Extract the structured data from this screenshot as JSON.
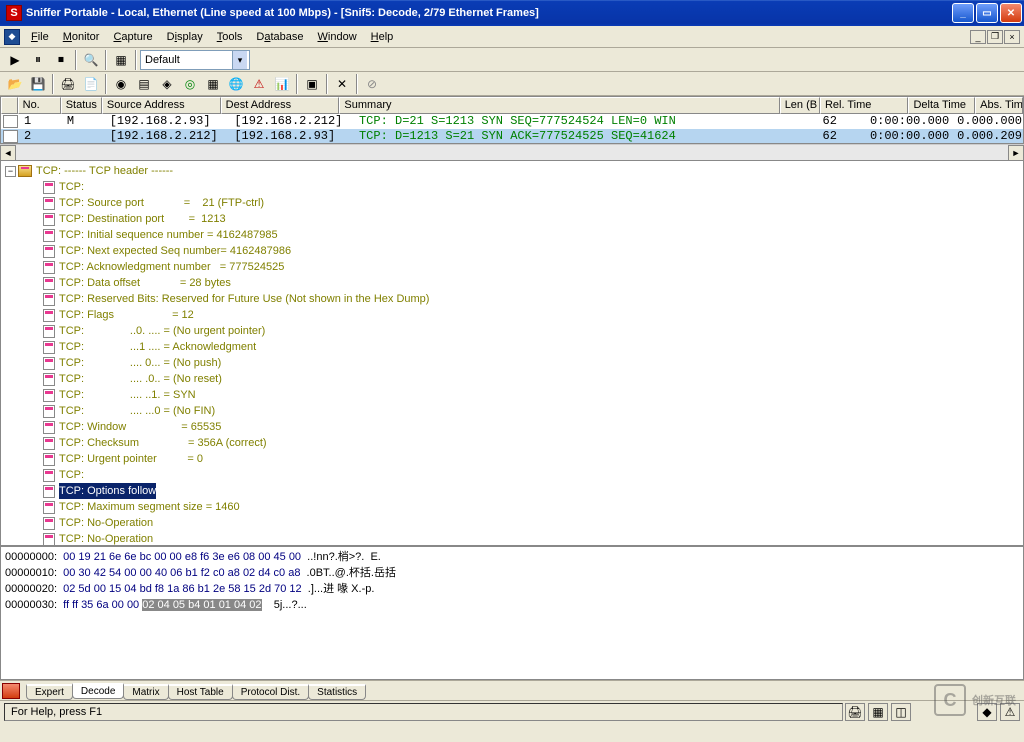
{
  "title": "Sniffer Portable - Local, Ethernet (Line speed at 100 Mbps) - [Snif5: Decode, 2/79 Ethernet Frames]",
  "menus": {
    "file": "File",
    "monitor": "Monitor",
    "capture": "Capture",
    "display": "Display",
    "tools": "Tools",
    "database": "Database",
    "window": "Window",
    "help": "Help"
  },
  "toolbar1": {
    "combo": "Default"
  },
  "packet_headers": {
    "no": "No.",
    "status": "Status",
    "src": "Source Address",
    "dst": "Dest Address",
    "summary": "Summary",
    "len": "Len (B",
    "rel": "Rel. Time",
    "delta": "Delta Time",
    "abs": "Abs. Time"
  },
  "packets": [
    {
      "no": "1",
      "status": "M",
      "src": "[192.168.2.93]",
      "dst": "[192.168.2.212]",
      "summary": "TCP: D=21 S=1213 SYN SEQ=777524524 LEN=0 WIN",
      "len": "62",
      "rel": "0:00:00.000",
      "delta": "0.000.000"
    },
    {
      "no": "2",
      "status": "",
      "src": "[192.168.2.212]",
      "dst": "[192.168.2.93]",
      "summary": "TCP: D=1213 S=21 SYN ACK=777524525 SEQ=41624",
      "len": "62",
      "rel": "0:00:00.000",
      "delta": "0.000.209"
    }
  ],
  "decode": {
    "header": "TCP: ------ TCP header ------",
    "lines": [
      "TCP:",
      "TCP: Source port             =    21 (FTP-ctrl)",
      "TCP: Destination port        =  1213",
      "TCP: Initial sequence number = 4162487985",
      "TCP: Next expected Seq number= 4162487986",
      "TCP: Acknowledgment number   = 777524525",
      "TCP: Data offset             = 28 bytes",
      "TCP: Reserved Bits: Reserved for Future Use (Not shown in the Hex Dump)",
      "TCP: Flags                   = 12",
      "TCP:               ..0. .... = (No urgent pointer)",
      "TCP:               ...1 .... = Acknowledgment",
      "TCP:               .... 0... = (No push)",
      "TCP:               .... .0.. = (No reset)",
      "TCP:               .... ..1. = SYN",
      "TCP:               .... ...0 = (No FIN)",
      "TCP: Window                  = 65535",
      "TCP: Checksum                = 356A (correct)",
      "TCP: Urgent pointer          = 0",
      "TCP:"
    ],
    "highlighted": "TCP: Options follow",
    "after": [
      "TCP: Maximum segment size = 1460",
      "TCP: No-Operation",
      "TCP: No-Operation"
    ]
  },
  "hex": [
    {
      "addr": "00000000:",
      "bytes": "00 19 21 6e 6e bc 00 00 e8 f6 3e e6 08 00 45 00",
      "ascii": "..!nn?.梢>?.  E."
    },
    {
      "addr": "00000010:",
      "bytes": "00 30 42 54 00 00 40 06 b1 f2 c0 a8 02 d4 c0 a8",
      "ascii": ".0BT..@.杯括.岳括"
    },
    {
      "addr": "00000020:",
      "bytes": "02 5d 00 15 04 bd f8 1a 86 b1 2e 58 15 2d 70 12",
      "ascii": ".]...进 喙 X.-p."
    },
    {
      "addr": "00000030:",
      "bytes": "ff ff 35 6a 00 00 ",
      "hlbytes": "02 04 05 b4 01 01 04 02",
      "ascii": "  5j...?..."
    }
  ],
  "tabs": [
    "Expert",
    "Decode",
    "Matrix",
    "Host Table",
    "Protocol Dist.",
    "Statistics"
  ],
  "active_tab": "Decode",
  "status": "For Help, press F1",
  "watermark": "创新互联"
}
